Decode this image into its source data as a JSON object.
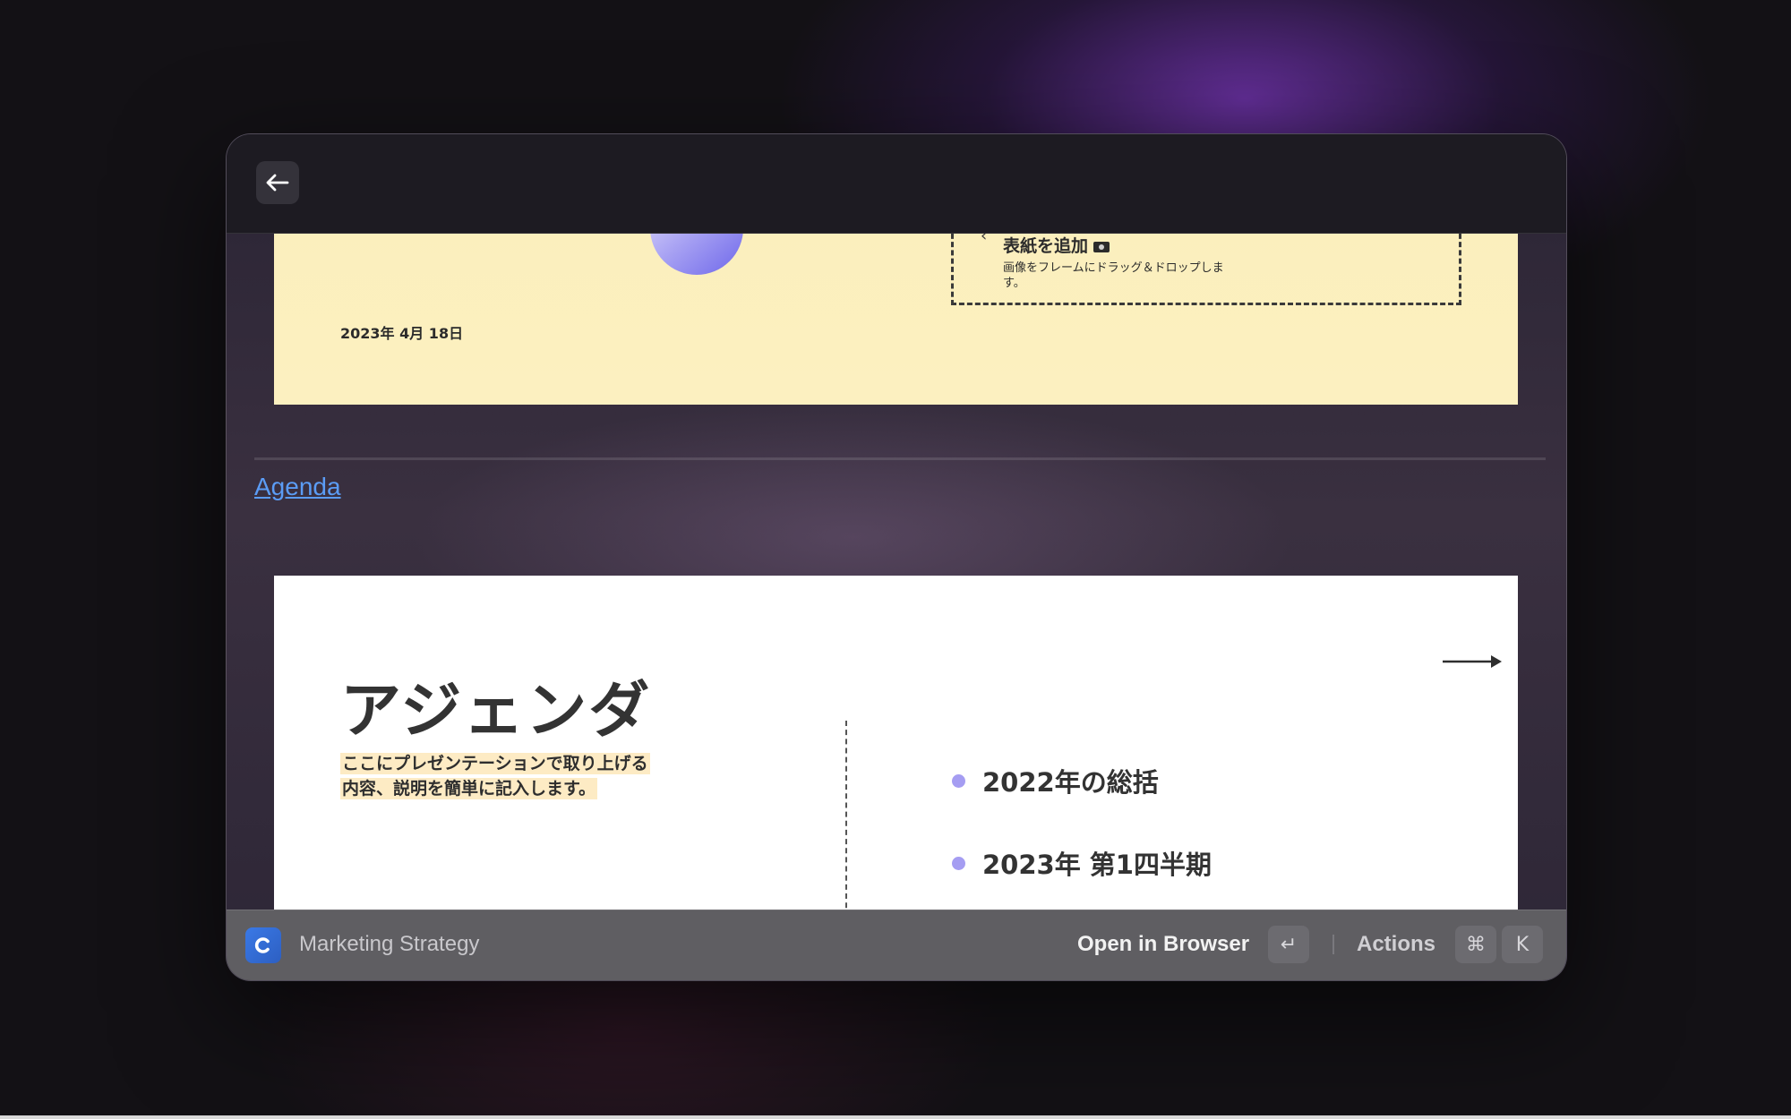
{
  "window": {
    "back_icon": "arrow-left-icon"
  },
  "cover_slide": {
    "date": "2023年 4月 18日",
    "dropzone_title": "表紙を追加",
    "dropzone_icon": "camera-icon",
    "dropzone_desc": "画像をフレームにドラッグ＆ドロップします。"
  },
  "section": {
    "link": "Agenda"
  },
  "agenda_slide": {
    "title": "アジェンダ",
    "desc_line1": "ここにプレゼンテーションで取り上げる",
    "desc_line2": "内容、説明を簡単に記入します。",
    "items": [
      {
        "label": "2022年の総括"
      },
      {
        "label": "2023年 第1四半期"
      }
    ],
    "arrow_icon": "arrow-right-icon",
    "bullet_color": "#a59df2"
  },
  "footer": {
    "app_icon": "canva-c-icon",
    "title": "Marketing Strategy",
    "primary_action": "Open in Browser",
    "primary_shortcut": "↵",
    "actions_label": "Actions",
    "actions_shortcut_mod": "⌘",
    "actions_shortcut_key": "K"
  },
  "colors": {
    "accent_link": "#5b9cf5",
    "cover_bg": "#fcf0c0",
    "app_icon_bg": "#3a79e6"
  }
}
